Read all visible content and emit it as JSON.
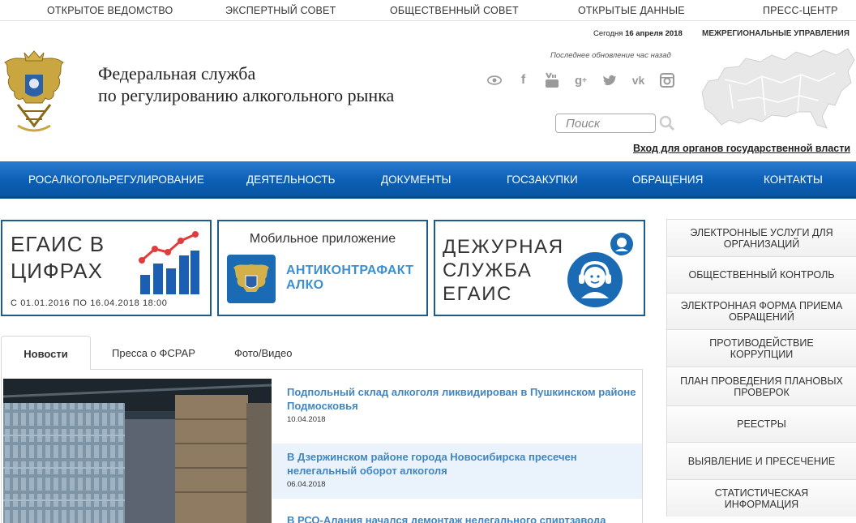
{
  "top_nav": [
    "ОТКРЫТОЕ ВЕДОМСТВО",
    "ЭКСПЕРТНЫЙ СОВЕТ",
    "ОБЩЕСТВЕННЫЙ СОВЕТ",
    "ОТКРЫТЫЕ ДАННЫЕ",
    "ПРЕСС-ЦЕНТР"
  ],
  "header": {
    "today_label": "Сегодня",
    "today_date": "16 апреля 2018",
    "regional_link": "МЕЖРЕГИОНАЛЬНЫЕ УПРАВЛЕНИЯ",
    "last_update": "Последнее обновление час назад",
    "org_line1": "Федеральная служба",
    "org_line2": "по регулированию алкогольного рынка",
    "search_placeholder": "Поиск",
    "login_link": "Вход для органов государственной власти",
    "social_icons": [
      "eye-icon",
      "facebook-icon",
      "youtube-icon",
      "google-plus-icon",
      "twitter-icon",
      "vk-icon",
      "instagram-icon"
    ]
  },
  "main_nav": [
    "РОСАЛКОГОЛЬРЕГУЛИРОВАНИЕ",
    "ДЕЯТЕЛЬНОСТЬ",
    "ДОКУМЕНТЫ",
    "ГОСЗАКУПКИ",
    "ОБРАЩЕНИЯ",
    "КОНТАКТЫ"
  ],
  "promo": {
    "egais_line1": "ЕГАИС в",
    "egais_line2": "цифрах",
    "egais_period": "С 01.01.2016 ПО 16.04.2018 18:00",
    "app_title": "Мобильное приложение",
    "app_name_line1": "АНТИКОНТРАФАКТ",
    "app_name_line2": "АЛКО",
    "duty_line1": "Дежурная",
    "duty_line2": "служба",
    "duty_line3": "ЕГАИС"
  },
  "tabs": [
    "Новости",
    "Пресса о ФСРАР",
    "Фото/Видео"
  ],
  "news": [
    {
      "title": "Подпольный склад алкоголя ликвидирован в Пушкинском районе Подмосковья",
      "date": "10.04.2018"
    },
    {
      "title": "В Дзержинском районе города Новосибирска пресечен нелегальный оборот алкоголя",
      "date": "06.04.2018"
    },
    {
      "title": "В РСО-Алания начался демонтаж нелегального спиртзавода",
      "date": ""
    }
  ],
  "sidebar": [
    "ЭЛЕКТРОННЫЕ УСЛУГИ ДЛЯ ОРГАНИЗАЦИЙ",
    "ОБЩЕСТВЕННЫЙ КОНТРОЛЬ",
    "ЭЛЕКТРОННАЯ ФОРМА ПРИЕМА ОБРАЩЕНИЙ",
    "ПРОТИВОДЕЙСТВИЕ КОРРУПЦИИ",
    "ПЛАН ПРОВЕДЕНИЯ ПЛАНОВЫХ ПРОВЕРОК",
    "РЕЕСТРЫ",
    "ВЫЯВЛЕНИЕ И ПРЕСЕЧЕНИЕ",
    "СТАТИСТИЧЕСКАЯ ИНФОРМАЦИЯ"
  ],
  "colors": {
    "nav_blue": "#0b5fb4",
    "box_border": "#1d5a8e",
    "link_blue": "#3f86c2",
    "highlight": "#eaf3fb"
  }
}
